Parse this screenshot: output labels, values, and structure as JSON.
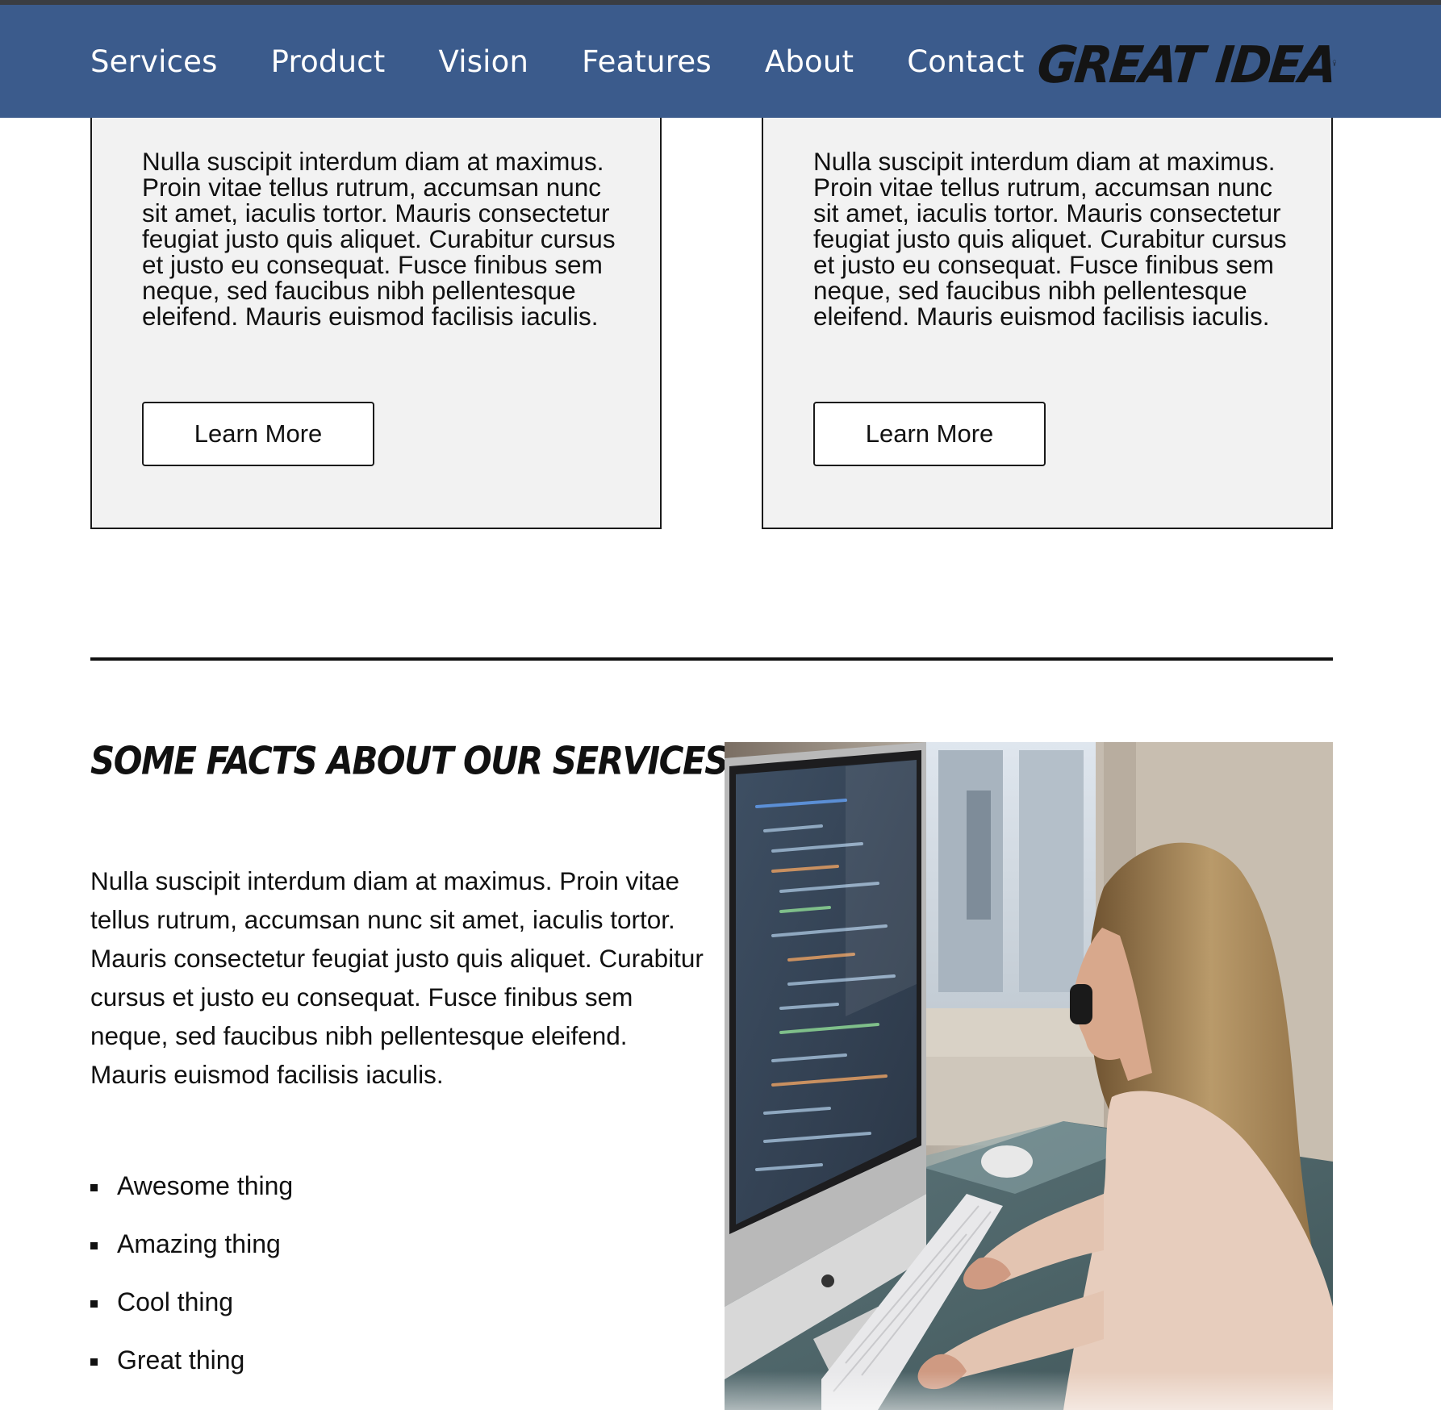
{
  "nav": {
    "items": [
      {
        "label": "Services"
      },
      {
        "label": "Product"
      },
      {
        "label": "Vision"
      },
      {
        "label": "Features"
      },
      {
        "label": "About"
      },
      {
        "label": "Contact"
      }
    ],
    "logo_text": "GREAT IDEA",
    "logo_icon": "lightbulb-icon",
    "background_color": "#3b5b8c"
  },
  "cards": [
    {
      "text": "Nulla suscipit interdum diam at maximus. Proin vitae tellus rutrum, accumsan nunc sit amet, iaculis tortor. Mauris consectetur feugiat justo quis aliquet. Curabitur cursus et justo eu consequat. Fusce finibus sem neque, sed faucibus nibh pellentesque eleifend. Mauris euismod facilisis iaculis.",
      "button_label": "Learn More"
    },
    {
      "text": "Nulla suscipit interdum diam at maximus. Proin vitae tellus rutrum, accumsan nunc sit amet, iaculis tortor. Mauris consectetur feugiat justo quis aliquet. Curabitur cursus et justo eu consequat. Fusce finibus sem neque, sed faucibus nibh pellentesque eleifend. Mauris euismod facilisis iaculis.",
      "button_label": "Learn More"
    }
  ],
  "facts": {
    "title": "Some facts about our services",
    "paragraph": "Nulla suscipit interdum diam at maximus. Proin vitae tellus rutrum, accumsan nunc sit amet, iaculis tortor. Mauris consectetur feugiat justo quis aliquet. Curabitur cursus et justo eu consequat. Fusce finibus sem neque, sed faucibus nibh pellentesque eleifend. Mauris euismod facilisis iaculis.",
    "items": [
      {
        "label": "Awesome thing"
      },
      {
        "label": "Amazing thing"
      },
      {
        "label": "Cool thing"
      },
      {
        "label": "Great thing"
      }
    ],
    "image": "photo-woman-coding-at-desktop-computer"
  }
}
